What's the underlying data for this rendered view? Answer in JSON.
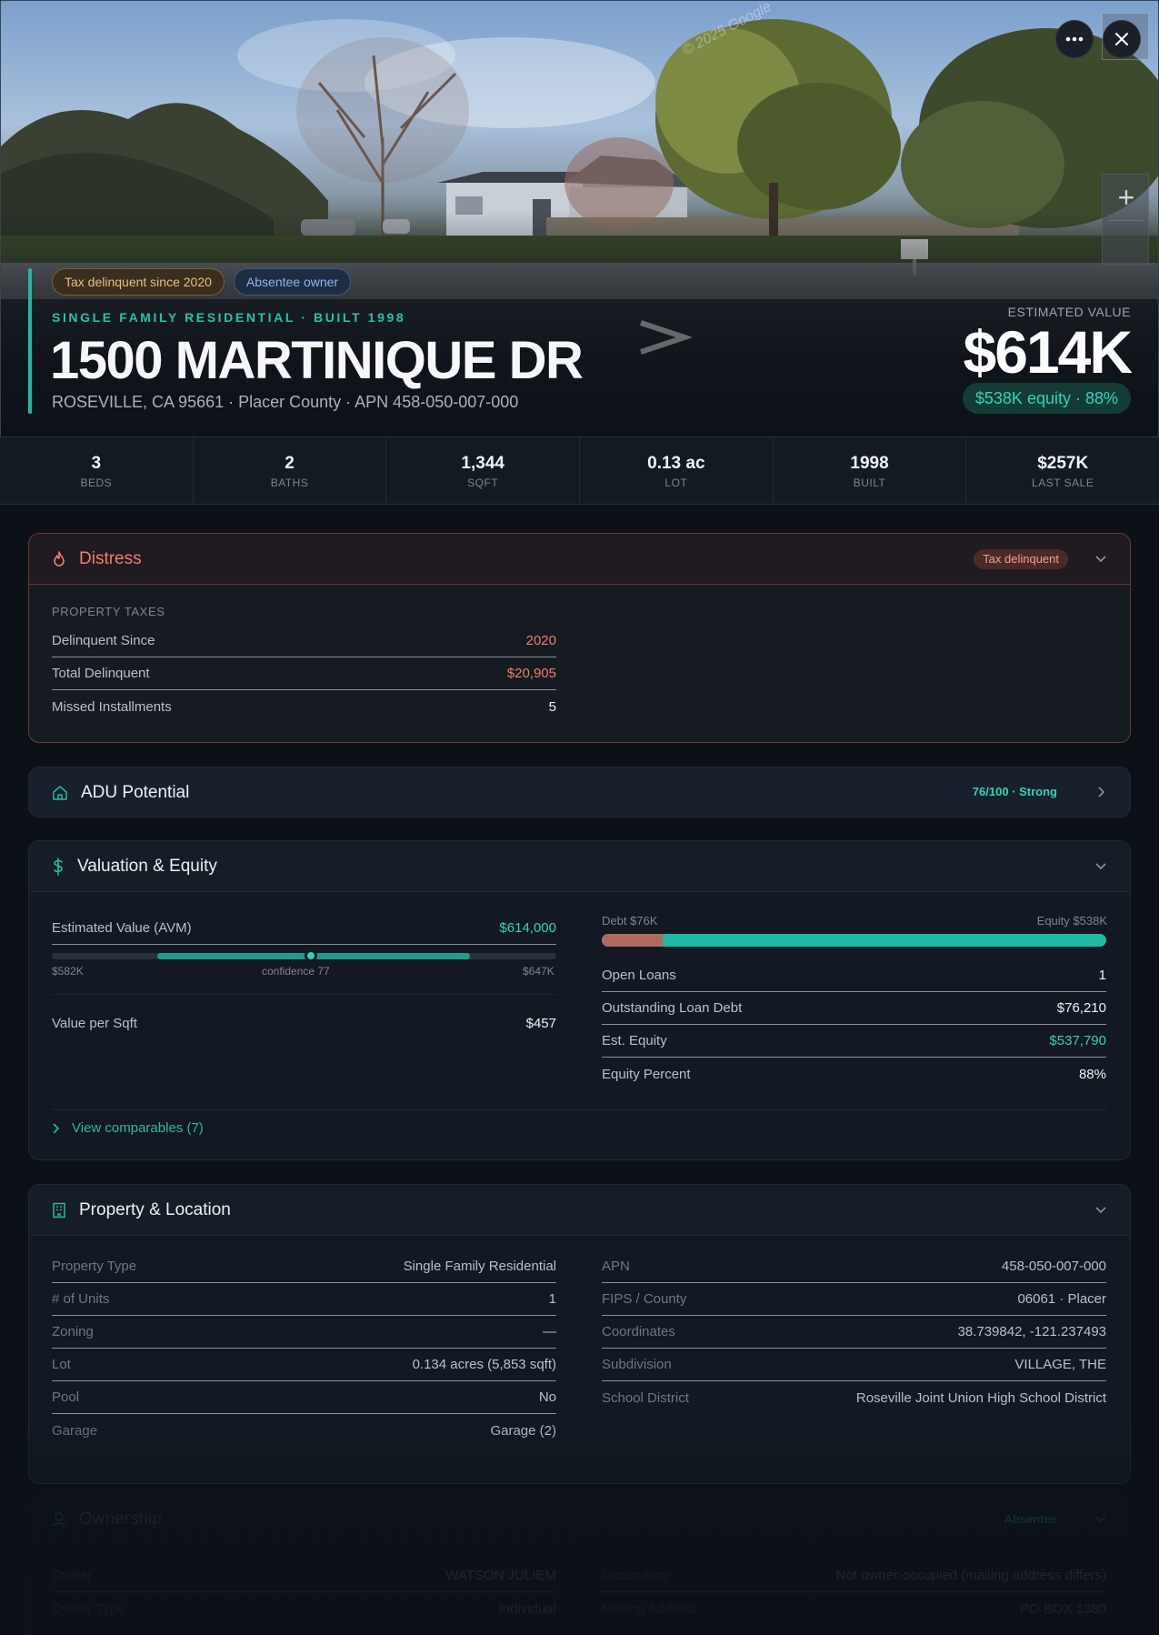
{
  "hero": {
    "watermark": "© 2025 Google",
    "badges": [
      "Tax delinquent since 2020",
      "Absentee owner"
    ],
    "eyebrow": "SINGLE FAMILY RESIDENTIAL · BUILT 1998",
    "address": "1500 MARTINIQUE DR",
    "subaddress": "ROSEVILLE, CA 95661 · Placer County · APN 458-050-007-000",
    "est_label": "ESTIMATED VALUE",
    "est_value": "$614K",
    "equity_pill": "$538K equity · 88%",
    "more_icon": "more-horizontal-icon",
    "close_icon": "close-icon",
    "zoom_in": "+"
  },
  "stats": [
    {
      "value": "3",
      "label": "BEDS"
    },
    {
      "value": "2",
      "label": "BATHS"
    },
    {
      "value": "1,344",
      "label": "SQFT"
    },
    {
      "value": "0.13 ac",
      "label": "LOT"
    },
    {
      "value": "1998",
      "label": "BUILT"
    },
    {
      "value": "$257K",
      "label": "LAST SALE"
    }
  ],
  "distress": {
    "title": "Distress",
    "pill": "Tax delinquent",
    "section": "PROPERTY TAXES",
    "rows": [
      {
        "k": "Delinquent Since",
        "v": "2020"
      },
      {
        "k": "Total Delinquent",
        "v": "$20,905"
      },
      {
        "k": "Missed Installments",
        "v": "5"
      }
    ]
  },
  "adu": {
    "title": "ADU Potential",
    "score": "76/100 · Strong"
  },
  "valuation": {
    "title": "Valuation & Equity",
    "avm_label": "Estimated Value (AVM)",
    "avm_value": "$614,000",
    "range_low": "$582K",
    "range_mid": "confidence 77",
    "range_high": "$647K",
    "slider": {
      "low": 582000,
      "value": 614000,
      "high": 647000
    },
    "vps_label": "Value per Sqft",
    "vps_value": "$457",
    "debt_label": "Debt $76K",
    "equity_label": "Equity $538K",
    "debt_fraction": 0.12,
    "rows": [
      {
        "k": "Open Loans",
        "v": "1"
      },
      {
        "k": "Outstanding Loan Debt",
        "v": "$76,210"
      },
      {
        "k": "Est. Equity",
        "v": "$537,790"
      },
      {
        "k": "Equity Percent",
        "v": "88%"
      }
    ],
    "comps_link": "View comparables (7)"
  },
  "property": {
    "title": "Property & Location",
    "left": [
      {
        "k": "Property Type",
        "v": "Single Family Residential"
      },
      {
        "k": "# of Units",
        "v": "1"
      },
      {
        "k": "Zoning",
        "v": "—"
      },
      {
        "k": "Lot",
        "v": "0.134 acres (5,853 sqft)"
      },
      {
        "k": "Pool",
        "v": "No"
      },
      {
        "k": "Garage",
        "v": "Garage (2)"
      }
    ],
    "right": [
      {
        "k": "APN",
        "v": "458-050-007-000"
      },
      {
        "k": "FIPS / County",
        "v": "06061 · Placer"
      },
      {
        "k": "Coordinates",
        "v": "38.739842, -121.237493"
      },
      {
        "k": "Subdivision",
        "v": "VILLAGE, THE"
      },
      {
        "k": "School District",
        "v": "Roseville Joint Union High School District"
      }
    ]
  },
  "ownership": {
    "title": "Ownership",
    "pill": "Absentee",
    "left": [
      {
        "k": "Owner",
        "v": "WATSON JULIEM"
      },
      {
        "k": "Owner Type",
        "v": "Individual"
      }
    ],
    "right": [
      {
        "k": "Occupancy",
        "v": "Not owner-occupied (mailing address differs)"
      },
      {
        "k": "Mailing Address",
        "v": "PO BOX 1380"
      }
    ]
  },
  "colors": {
    "accent": "#1fb8a0",
    "distress": "#ef7f6e",
    "background": "#0c1117"
  }
}
